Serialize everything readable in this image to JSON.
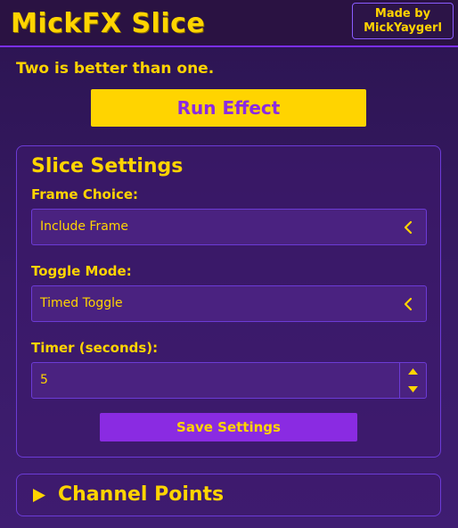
{
  "header": {
    "title": "MickFX Slice",
    "credit_line1": "Made by",
    "credit_line2": "MickYaygerl"
  },
  "tagline": "Two is better than one.",
  "run_button": "Run Effect",
  "slice_settings": {
    "title": "Slice Settings",
    "frame_choice": {
      "label": "Frame Choice:",
      "value": "Include Frame",
      "icon": "chevron-left-icon"
    },
    "toggle_mode": {
      "label": "Toggle Mode:",
      "value": "Timed Toggle",
      "icon": "chevron-left-icon"
    },
    "timer": {
      "label": "Timer (seconds):",
      "value": "5"
    },
    "save_button": "Save Settings"
  },
  "channel_points": {
    "label": "Channel Points",
    "icon": "triangle-right-icon"
  },
  "colors": {
    "accent_yellow": "#ffd400",
    "accent_purple": "#8a2be2",
    "background": "#381a66"
  }
}
